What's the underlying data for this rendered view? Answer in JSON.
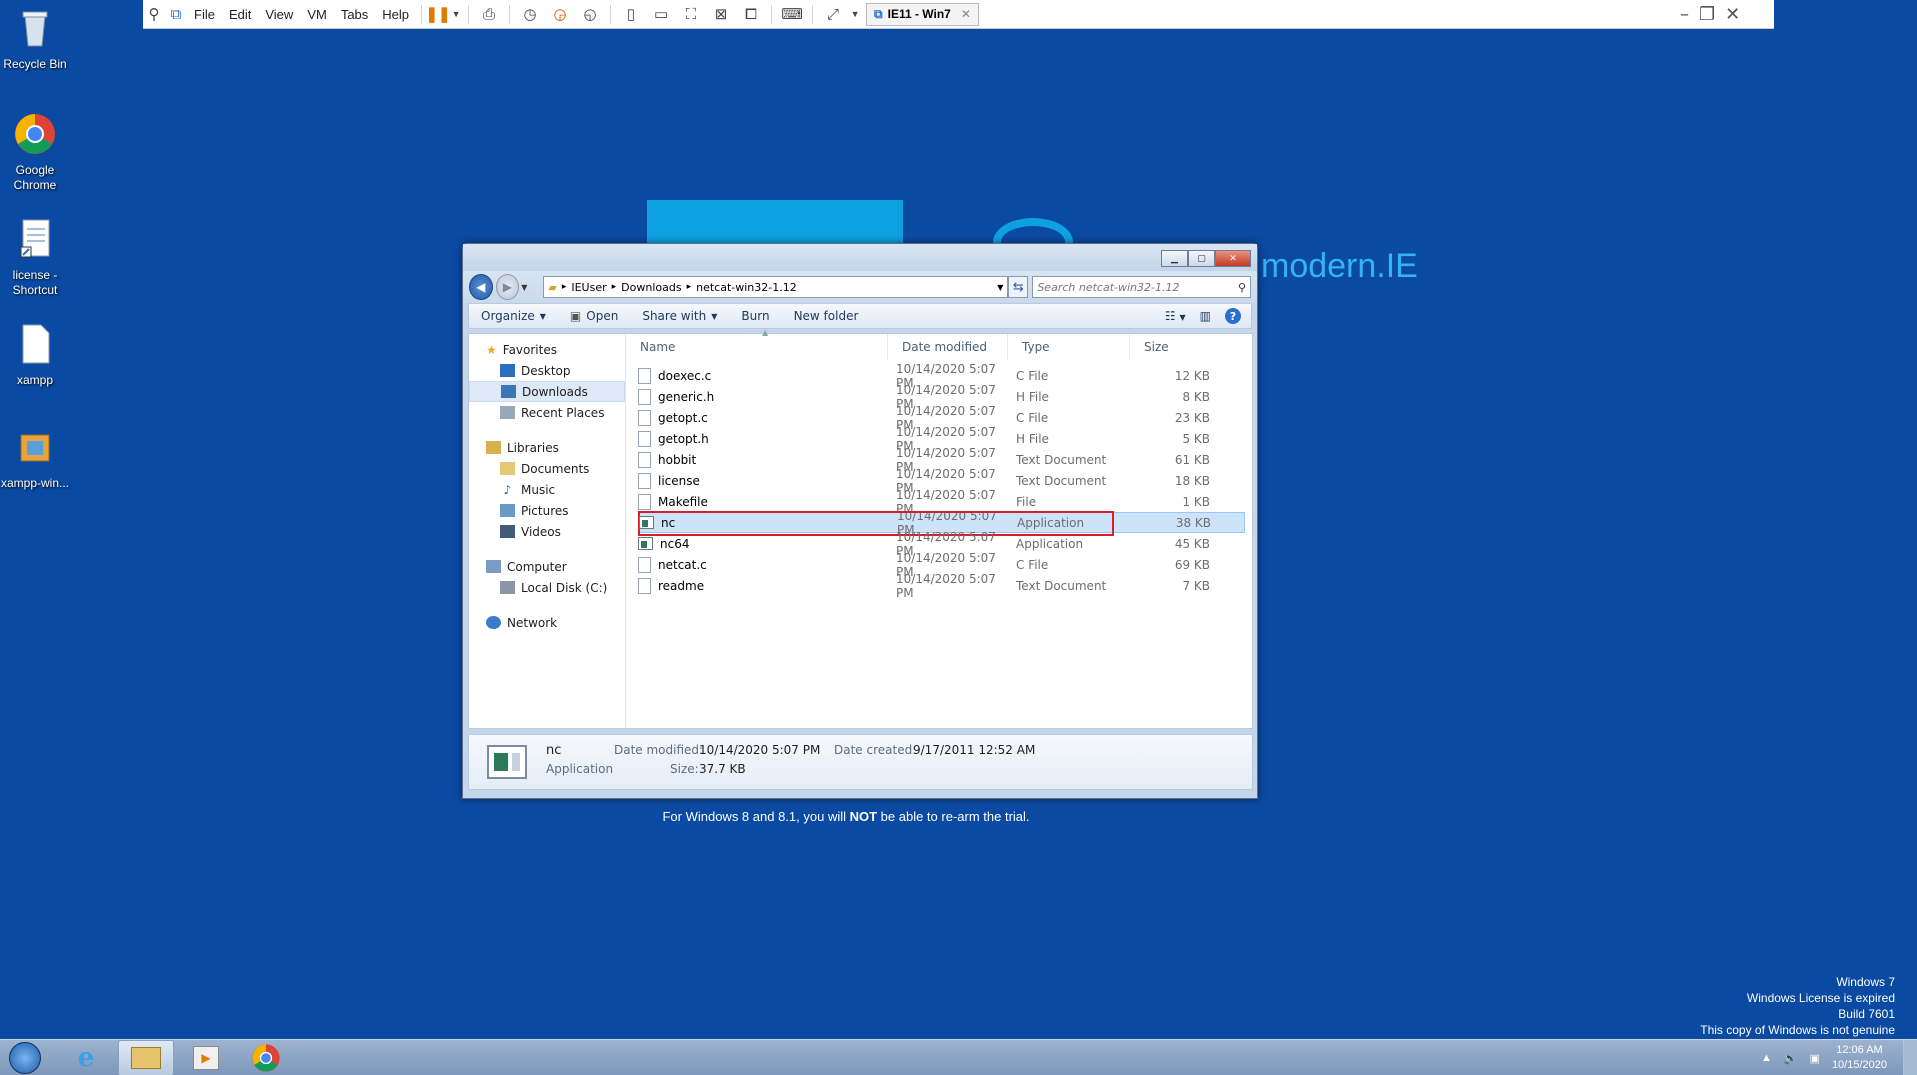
{
  "vm": {
    "menu": [
      "File",
      "Edit",
      "View",
      "VM",
      "Tabs",
      "Help"
    ],
    "tab_label": "IE11 - Win7"
  },
  "desktop": {
    "icons": [
      {
        "label": "Recycle Bin",
        "icon": "recycle-bin-icon"
      },
      {
        "label": "Google Chrome",
        "icon": "chrome-icon"
      },
      {
        "label": "license - Shortcut",
        "icon": "document-shortcut-icon"
      },
      {
        "label": "xampp",
        "icon": "text-file-icon"
      },
      {
        "label": "xampp-win...",
        "icon": "installer-icon"
      }
    ],
    "background_logo": "modern.IE",
    "note_prefix": "For Windows 8 and 8.1, you will ",
    "note_bold": "NOT",
    "note_suffix": " be able to re-arm the trial."
  },
  "explorer": {
    "breadcrumb": [
      "IEUser",
      "Downloads",
      "netcat-win32-1.12"
    ],
    "search_placeholder": "Search netcat-win32-1.12",
    "toolbar": {
      "organize": "Organize",
      "open": "Open",
      "share": "Share with",
      "burn": "Burn",
      "new_folder": "New folder"
    },
    "nav": {
      "favorites": "Favorites",
      "desktop": "Desktop",
      "downloads": "Downloads",
      "recent": "Recent Places",
      "libraries": "Libraries",
      "documents": "Documents",
      "music": "Music",
      "pictures": "Pictures",
      "videos": "Videos",
      "computer": "Computer",
      "local_disk": "Local Disk (C:)",
      "network": "Network"
    },
    "columns": {
      "name": "Name",
      "date": "Date modified",
      "type": "Type",
      "size": "Size"
    },
    "files": [
      {
        "name": "doexec.c",
        "date": "10/14/2020 5:07 PM",
        "type": "C File",
        "size": "12 KB"
      },
      {
        "name": "generic.h",
        "date": "10/14/2020 5:07 PM",
        "type": "H File",
        "size": "8 KB"
      },
      {
        "name": "getopt.c",
        "date": "10/14/2020 5:07 PM",
        "type": "C File",
        "size": "23 KB"
      },
      {
        "name": "getopt.h",
        "date": "10/14/2020 5:07 PM",
        "type": "H File",
        "size": "5 KB"
      },
      {
        "name": "hobbit",
        "date": "10/14/2020 5:07 PM",
        "type": "Text Document",
        "size": "61 KB"
      },
      {
        "name": "license",
        "date": "10/14/2020 5:07 PM",
        "type": "Text Document",
        "size": "18 KB"
      },
      {
        "name": "Makefile",
        "date": "10/14/2020 5:07 PM",
        "type": "File",
        "size": "1 KB"
      },
      {
        "name": "nc",
        "date": "10/14/2020 5:07 PM",
        "type": "Application",
        "size": "38 KB"
      },
      {
        "name": "nc64",
        "date": "10/14/2020 5:07 PM",
        "type": "Application",
        "size": "45 KB"
      },
      {
        "name": "netcat.c",
        "date": "10/14/2020 5:07 PM",
        "type": "C File",
        "size": "69 KB"
      },
      {
        "name": "readme",
        "date": "10/14/2020 5:07 PM",
        "type": "Text Document",
        "size": "7 KB"
      }
    ],
    "selected_index": 7,
    "details": {
      "name": "nc",
      "type": "Application",
      "date_modified_label": "Date modified:",
      "date_modified": "10/14/2020 5:07 PM",
      "size_label": "Size:",
      "size": "37.7 KB",
      "date_created_label": "Date created:",
      "date_created": "9/17/2011 12:52 AM"
    }
  },
  "watermark": [
    "Windows 7",
    "Windows License is expired",
    "Build 7601",
    "This copy of Windows is not genuine"
  ],
  "clock": {
    "time": "12:06 AM",
    "date": "10/15/2020"
  },
  "colors": {
    "desktop": "#0a4aa2",
    "highlight_box": "#d71e2c",
    "selection": "#cce3fa"
  }
}
